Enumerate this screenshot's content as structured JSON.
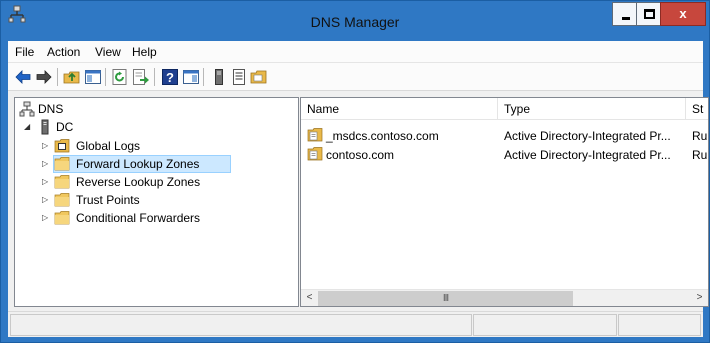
{
  "window": {
    "title": "DNS Manager",
    "colors": {
      "titlebar": "#2f78c4",
      "close": "#c7473d",
      "selection": "#cce8ff"
    }
  },
  "menu": {
    "file": "File",
    "action": "Action",
    "view": "View",
    "help": "Help"
  },
  "toolbar": {
    "icons": [
      "back-arrow-icon",
      "forward-arrow-icon",
      "up-folder-icon",
      "show-hide-tree-icon",
      "refresh-icon",
      "export-list-icon",
      "help-icon",
      "show-hide-action-pane-icon",
      "server-icon",
      "list-view-icon",
      "zone-folder-icon"
    ]
  },
  "tree": {
    "root": {
      "label": "DNS"
    },
    "server": {
      "label": "DC",
      "expander": "◢"
    },
    "items": [
      {
        "label": "Global Logs",
        "expander": "▷"
      },
      {
        "label": "Forward Lookup Zones",
        "expander": "▷"
      },
      {
        "label": "Reverse Lookup Zones",
        "expander": "▷"
      },
      {
        "label": "Trust Points",
        "expander": "▷"
      },
      {
        "label": "Conditional Forwarders",
        "expander": "▷"
      }
    ]
  },
  "list": {
    "columns": {
      "name": "Name",
      "type": "Type",
      "status": "St"
    },
    "rows": [
      {
        "name": "_msdcs.contoso.com",
        "type": "Active Directory-Integrated Pr...",
        "status": "Ru"
      },
      {
        "name": "contoso.com",
        "type": "Active Directory-Integrated Pr...",
        "status": "Ru"
      }
    ]
  },
  "scroll": {
    "left": "<",
    "right": ">",
    "grip": "III"
  }
}
